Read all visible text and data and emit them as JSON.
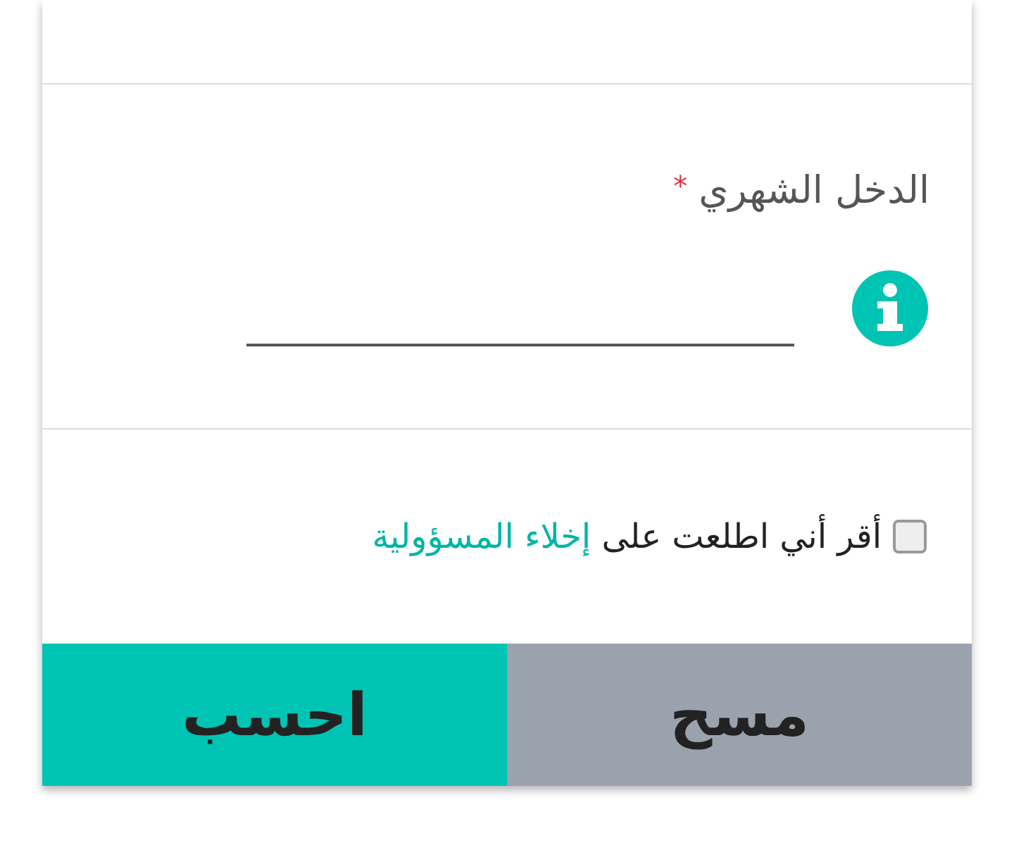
{
  "income_field": {
    "label": "الدخل الشهري",
    "required_mark": "*"
  },
  "consent": {
    "checked": false,
    "text": "أقر أني اطلعت على",
    "link": "إخلاء المسؤولية"
  },
  "buttons": [
    {
      "label": "مسح",
      "kind": "secondary"
    },
    {
      "label": "احسب",
      "kind": "primary"
    }
  ]
}
